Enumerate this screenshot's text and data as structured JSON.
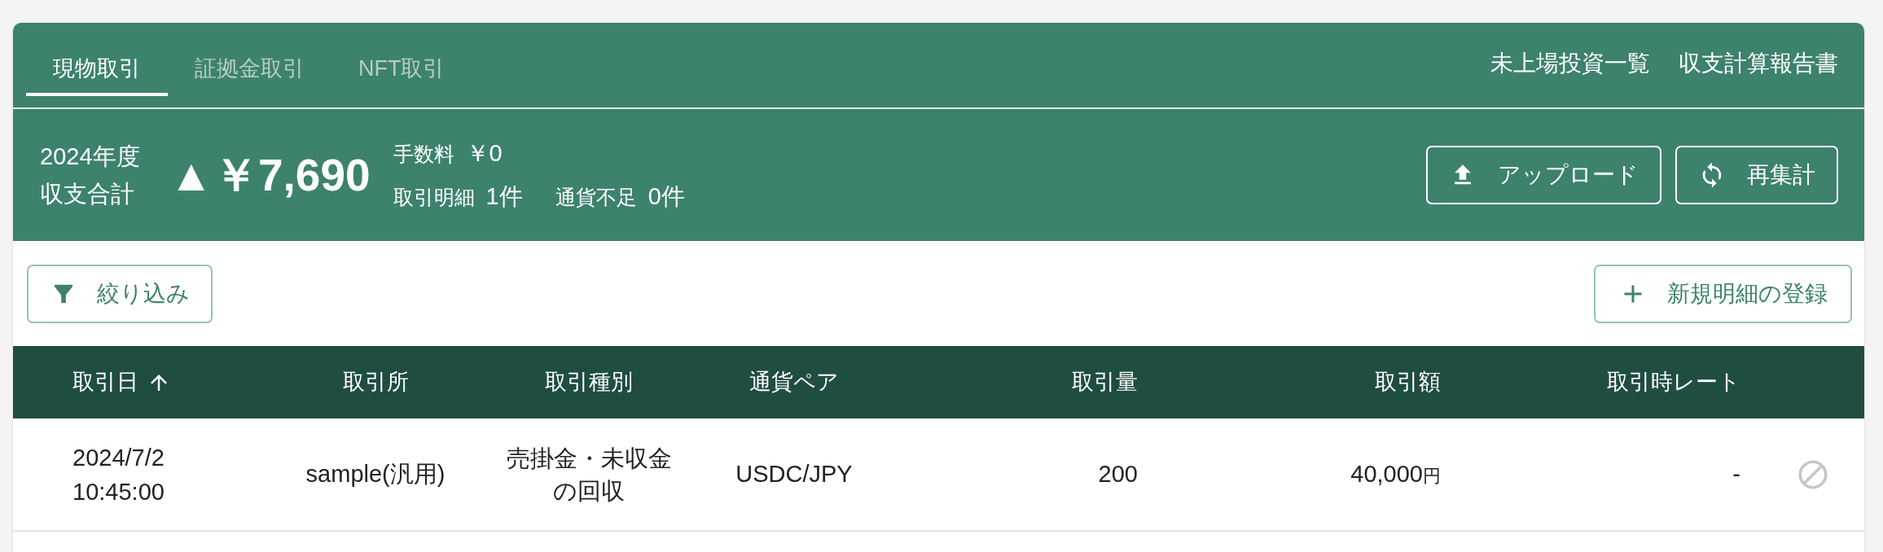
{
  "tabs": [
    {
      "label": "現物取引",
      "selected": true
    },
    {
      "label": "証拠金取引",
      "selected": false
    },
    {
      "label": "NFT取引",
      "selected": false
    }
  ],
  "nav_links": [
    {
      "label": "未上場投資一覧"
    },
    {
      "label": "収支計算報告書"
    }
  ],
  "summary": {
    "period": "2024年度",
    "title": "収支合計",
    "total": "▲￥7,690",
    "stat_lines": [
      [
        {
          "label": "手数料",
          "value": "￥0"
        }
      ],
      [
        {
          "label": "取引明細",
          "value": "1件"
        },
        {
          "label": "通貨不足",
          "value": "0件"
        }
      ]
    ]
  },
  "actions": [
    {
      "kind": "upload",
      "label": "アップロード"
    },
    {
      "kind": "refresh",
      "label": "再集計"
    }
  ],
  "toolbar": {
    "filter": {
      "label": "絞り込み"
    },
    "add": {
      "label": "新規明細の登録"
    }
  },
  "table": {
    "columns": [
      {
        "label": "取引日",
        "sorted": true,
        "ascending": true
      },
      {
        "label": "取引所",
        "sorted": false
      },
      {
        "label": "取引種別",
        "sorted": false
      },
      {
        "label": "通貨ペア",
        "sorted": false
      },
      {
        "label": "取引量",
        "sorted": false
      },
      {
        "label": "取引額",
        "sorted": false
      },
      {
        "label": "取引時レート",
        "sorted": false
      }
    ],
    "rows": [
      {
        "date": "2024/7/2",
        "time": "10:45:00",
        "exchange": "sample(汎用)",
        "type": "売掛金・未収金の回収",
        "pair": "USDC/JPY",
        "quantity": "200",
        "amount": "40,000",
        "amount_unit": "円",
        "rate": "-"
      }
    ]
  }
}
